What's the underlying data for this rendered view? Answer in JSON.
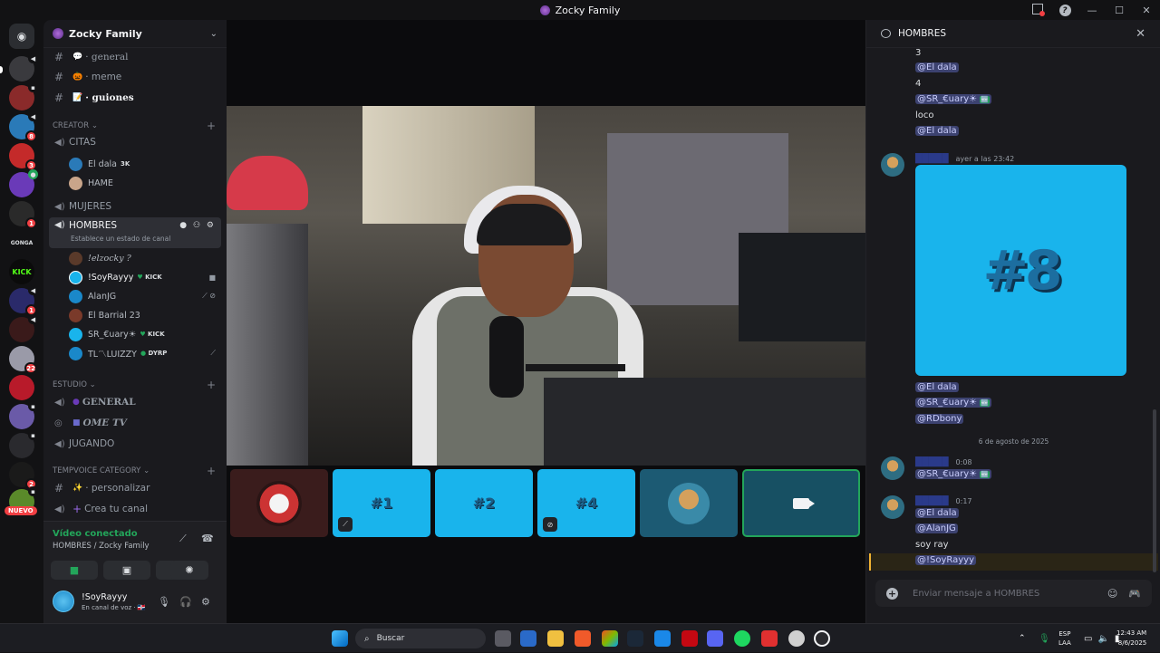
{
  "window": {
    "title": "Zocky Family"
  },
  "guilds": [
    {
      "badge": ""
    },
    {
      "badge": ""
    },
    {
      "badge": "8"
    },
    {
      "badge": "3"
    },
    {
      "badge": ""
    },
    {
      "badge": "1"
    },
    {
      "badge": ""
    },
    {
      "badge": ""
    },
    {
      "badge": "1"
    },
    {
      "badge": ""
    },
    {
      "badge": "22"
    },
    {
      "badge": ""
    },
    {
      "badge": ""
    },
    {
      "badge": ""
    },
    {
      "badge": "2"
    },
    {
      "badge": ""
    }
  ],
  "guild_labels": {
    "nuevo": "NUEVO",
    "gonga": "GONGA",
    "kick": "KICK"
  },
  "sidebar": {
    "server_name": "Zocky Family",
    "channels_top": [
      {
        "emoji": "💬",
        "label": "· general"
      },
      {
        "emoji": "🎃",
        "label": "· meme"
      },
      {
        "emoji": "📝",
        "label": "· guiones"
      }
    ],
    "categories": {
      "creator": "CREATOR",
      "estudio": "ESTUDIO",
      "tempvoice": "TEMPVOICE CATEGORY"
    },
    "voice_citas": "CITAS",
    "citas_users": [
      {
        "name": "El dala",
        "tag": "3K"
      },
      {
        "name": "HAME",
        "tag": ""
      }
    ],
    "voice_mujeres": "MUJERES",
    "voice_hombres": "HOMBRES",
    "hombres_status": "Establece un estado de canal",
    "hombres_users": [
      {
        "name": "!elzocky ?",
        "tag": ""
      },
      {
        "name": "!SoyRayyy",
        "tag": "KICK"
      },
      {
        "name": "AlanJG",
        "tag": ""
      },
      {
        "name": "El Barrial 23",
        "tag": ""
      },
      {
        "name": "SR_€uary☀",
        "tag": "KICK"
      },
      {
        "name": "TL〽LUIZZY",
        "tag": "DYRP"
      }
    ],
    "estudio_channels": [
      "GENERAL",
      "OME TV",
      "JUGANDO"
    ],
    "temp_channels": [
      "· personalizar",
      "Crea tu canal"
    ]
  },
  "voice_panel": {
    "status": "Vídeo conectado",
    "location": "HOMBRES / Zocky Family"
  },
  "user_panel": {
    "name": "!SoyRayyy",
    "status": "En canal de voz · 🇩🇴"
  },
  "tiles": [
    {
      "label": ""
    },
    {
      "label": "#1"
    },
    {
      "label": "#2"
    },
    {
      "label": "#4"
    },
    {
      "label": ""
    },
    {
      "label": ""
    }
  ],
  "chat": {
    "header": "HOMBRES",
    "lines_top": [
      "3",
      "@El dala",
      "4",
      "@SR_€uary☀",
      "loco",
      "@El dala"
    ],
    "msg1_time": "ayer a las 23:42",
    "embed_text": "#8",
    "after_embed": [
      "@El dala",
      "@SR_€uary☀",
      "@RDbony"
    ],
    "date_divider": "6 de agosto de 2025",
    "msg2_time": "0:08",
    "msg2_line": "@SR_€uary☀",
    "msg3_time": "0:17",
    "msg3_lines": [
      "@El dala",
      "@AlanJG",
      "soy ray",
      "@!SoyRayyy"
    ],
    "placeholder": "Enviar mensaje a HOMBRES"
  },
  "taskbar": {
    "search": "Buscar",
    "lang_top": "ESP",
    "lang_bottom": "LAA",
    "time": "12:43 AM",
    "date": "8/6/2025"
  }
}
